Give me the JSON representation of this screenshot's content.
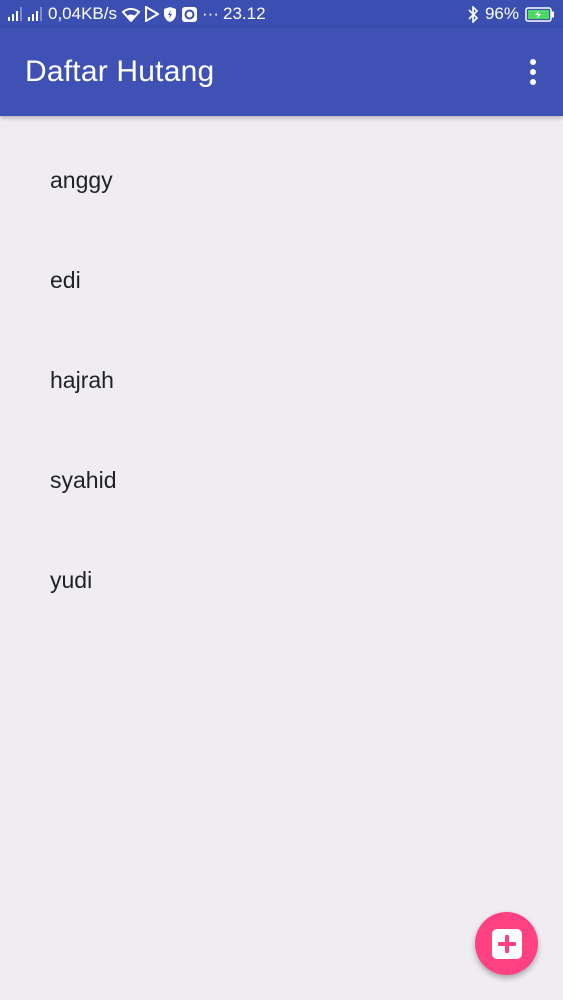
{
  "status_bar": {
    "network_speed": "0,04KB/s",
    "more": "···",
    "time": "23.12",
    "battery": "96%"
  },
  "app_bar": {
    "title": "Daftar Hutang"
  },
  "list": {
    "items": [
      "anggy",
      "edi",
      "hajrah",
      "syahid",
      "yudi"
    ]
  },
  "fab": {
    "icon": "add-box-icon"
  },
  "colors": {
    "primary": "#3f51b5",
    "status_bar": "#3a4fb1",
    "accent": "#ff4081",
    "background": "#efedf1"
  }
}
